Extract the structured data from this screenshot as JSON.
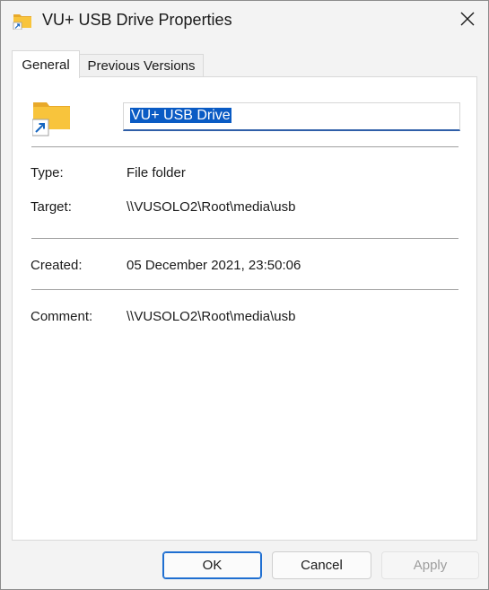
{
  "window": {
    "title": "VU+ USB Drive Properties",
    "title_icon": "folder-shortcut-icon",
    "close_icon": "close-icon"
  },
  "tabs": [
    {
      "label": "General",
      "selected": true
    },
    {
      "label": "Previous Versions",
      "selected": false
    }
  ],
  "general": {
    "icon": "folder-shortcut-icon",
    "name_value": "VU+ USB Drive",
    "fields": [
      {
        "label": "Type:",
        "value": "File folder"
      },
      {
        "label": "Target:",
        "value": "\\\\VUSOLO2\\Root\\media\\usb"
      },
      {
        "label": "Created:",
        "value": "05 December 2021, 23:50:06"
      },
      {
        "label": "Comment:",
        "value": "\\\\VUSOLO2\\Root\\media\\usb"
      }
    ]
  },
  "buttons": {
    "ok": "OK",
    "cancel": "Cancel",
    "apply": "Apply"
  },
  "colors": {
    "folder": "#f8c43c",
    "selection": "#0a5bc4",
    "accent": "#1f6fd1"
  }
}
